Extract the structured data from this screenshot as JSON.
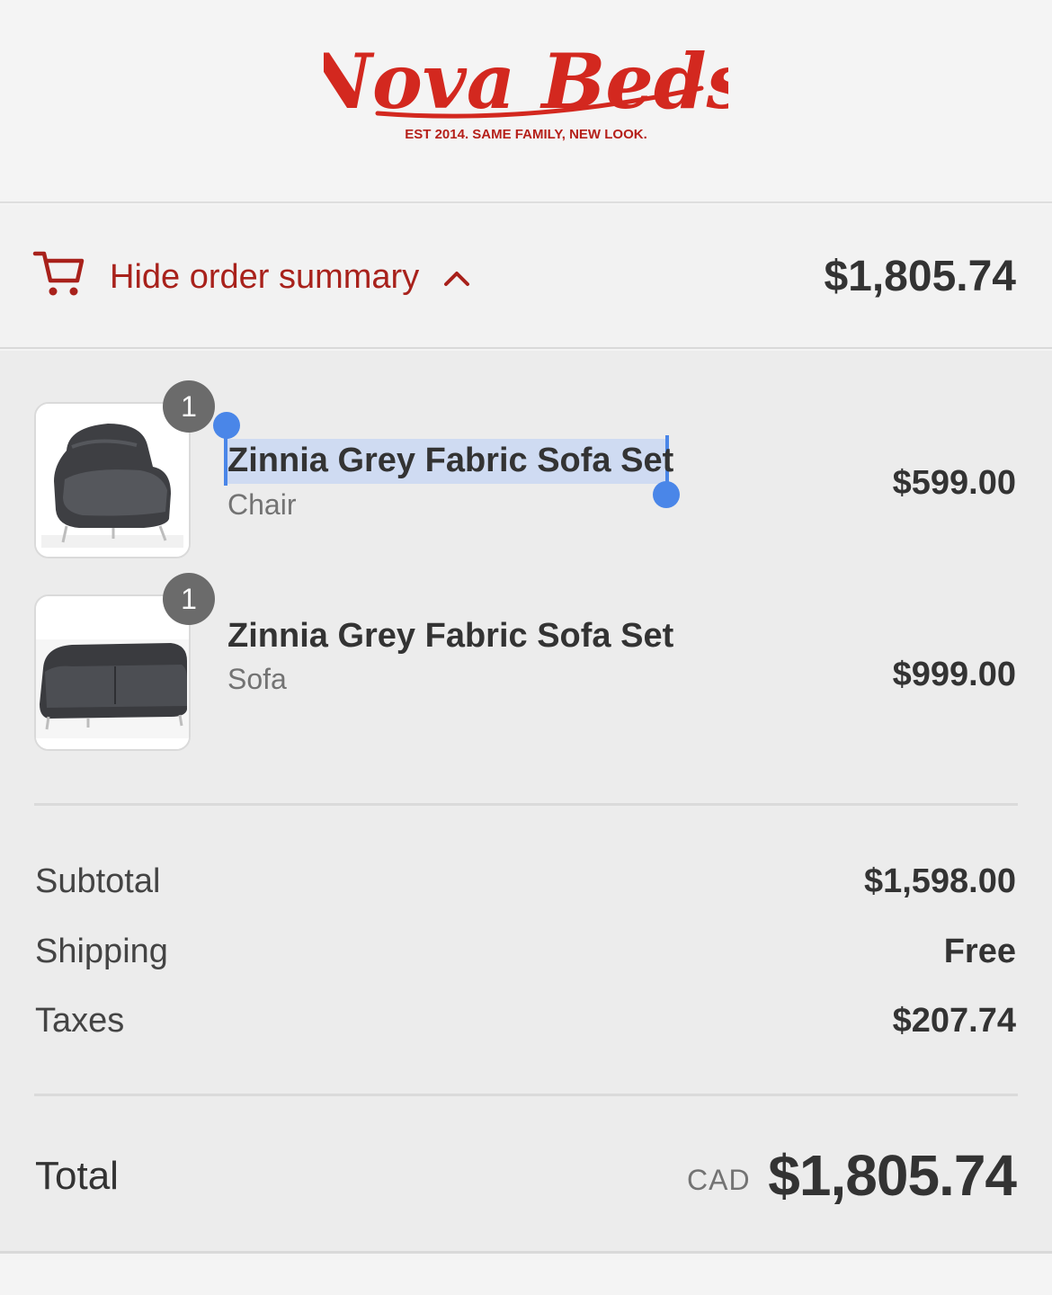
{
  "brand": {
    "name": "Nova Beds",
    "tagline": "EST 2014. SAME FAMILY, NEW LOOK.",
    "color": "#d3281f"
  },
  "summary_toggle": {
    "label": "Hide order summary",
    "total": "$1,805.74",
    "icons": [
      "cart-icon",
      "chevron-up-icon"
    ],
    "accent_color": "#a8211b"
  },
  "line_items": [
    {
      "quantity": "1",
      "title": "Zinnia Grey Fabric Sofa Set",
      "variant": "Chair",
      "price": "$599.00",
      "thumbnail": "grey armchair",
      "selected": true
    },
    {
      "quantity": "1",
      "title": "Zinnia Grey Fabric Sofa Set",
      "variant": "Sofa",
      "price": "$999.00",
      "thumbnail": "grey sofa",
      "selected": false
    }
  ],
  "totals": {
    "subtotal_label": "Subtotal",
    "subtotal_value": "$1,598.00",
    "shipping_label": "Shipping",
    "shipping_value": "Free",
    "taxes_label": "Taxes",
    "taxes_value": "$207.74",
    "total_label": "Total",
    "currency": "CAD",
    "total_value": "$1,805.74"
  },
  "selection_color": "#4a86e8"
}
